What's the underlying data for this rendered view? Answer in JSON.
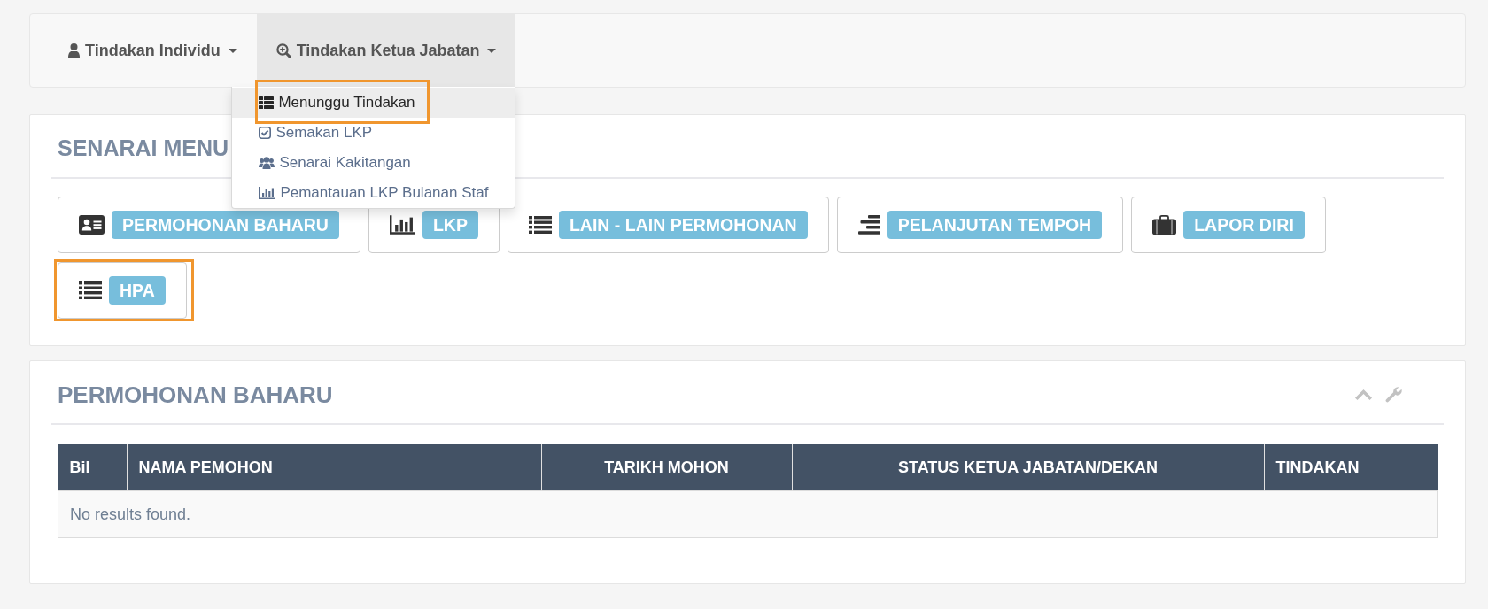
{
  "navbar": {
    "items": [
      {
        "label": "Tindakan Individu",
        "expanded": false
      },
      {
        "label": "Tindakan Ketua Jabatan",
        "expanded": true,
        "menu": [
          {
            "label": "Menunggu Tindakan",
            "selected": true,
            "highlighted": true
          },
          {
            "label": "Semakan LKP",
            "selected": false,
            "highlighted": false
          },
          {
            "label": "Senarai Kakitangan",
            "selected": false,
            "highlighted": false
          },
          {
            "label": "Pemantauan LKP Bulanan Staf",
            "selected": false,
            "highlighted": false
          }
        ]
      }
    ]
  },
  "menu_panel": {
    "title": "SENARAI MENU",
    "buttons": [
      {
        "label": "PERMOHONAN BAHARU",
        "highlighted": false
      },
      {
        "label": "LKP",
        "highlighted": false
      },
      {
        "label": "LAIN - LAIN PERMOHONAN",
        "highlighted": false
      },
      {
        "label": "PELANJUTAN TEMPOH",
        "highlighted": false
      },
      {
        "label": "LAPOR DIRI",
        "highlighted": false
      },
      {
        "label": "HPA",
        "highlighted": true
      }
    ]
  },
  "results_panel": {
    "title": "PERMOHONAN BAHARU",
    "table": {
      "columns": [
        "Bil",
        "NAMA PEMOHON",
        "TARIKH MOHON",
        "STATUS KETUA JABATAN/DEKAN",
        "TINDAKAN"
      ],
      "empty_message": "No results found."
    }
  }
}
